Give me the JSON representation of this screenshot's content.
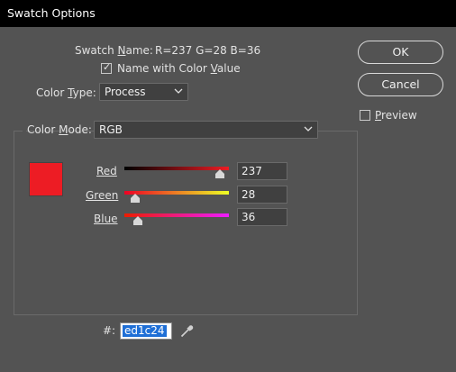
{
  "window": {
    "title": "Swatch Options"
  },
  "swatch_name": {
    "label": "Swatch Name:",
    "value": "R=237 G=28 B=36"
  },
  "name_with_color_value": {
    "label": "Name with Color Value",
    "checked": true
  },
  "color_type": {
    "label": "Color Type:",
    "value": "Process"
  },
  "color_mode": {
    "label": "Color Mode:",
    "value": "RGB"
  },
  "swatch_color": "#ed1c24",
  "channels": {
    "red": {
      "label": "Red",
      "value": "237"
    },
    "green": {
      "label": "Green",
      "value": "28"
    },
    "blue": {
      "label": "Blue",
      "value": "36"
    }
  },
  "hex": {
    "label": "#:",
    "value": "ed1c24"
  },
  "buttons": {
    "ok": "OK",
    "cancel": "Cancel"
  },
  "preview": {
    "label": "Preview",
    "checked": false
  }
}
